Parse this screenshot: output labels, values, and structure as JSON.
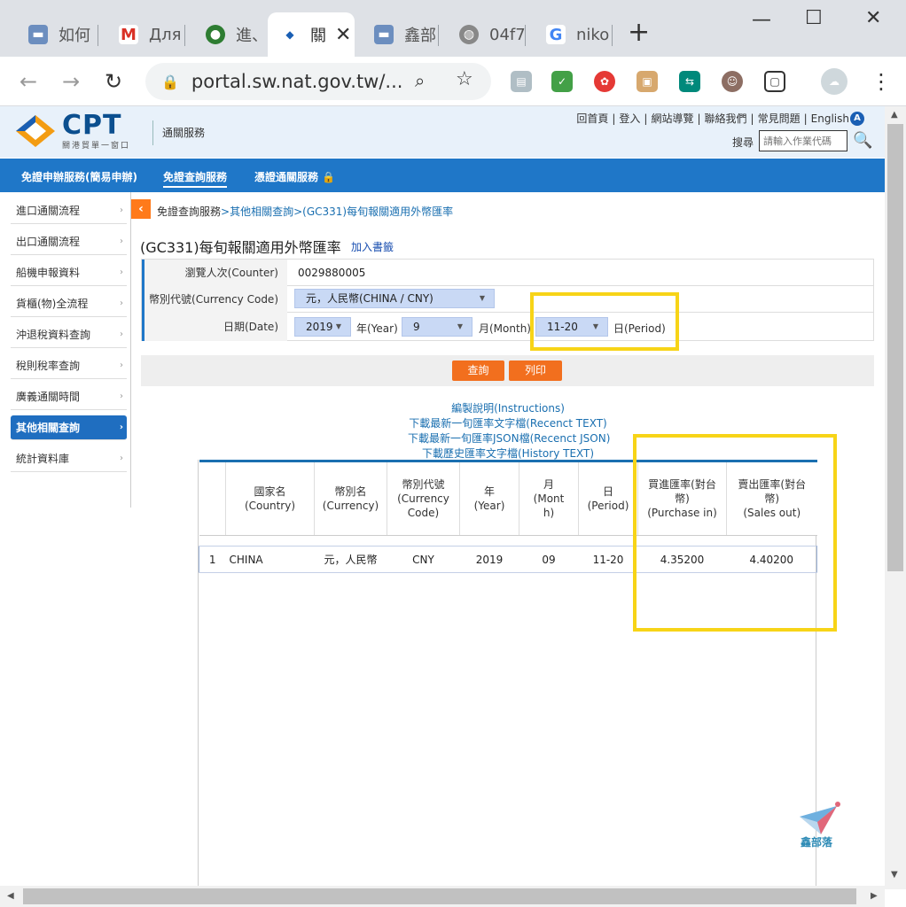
{
  "browser": {
    "tabs": [
      {
        "label": "如何",
        "icon": "chat-icon"
      },
      {
        "label": "Для",
        "icon": "gmail-icon"
      },
      {
        "label": "進、",
        "icon": "emblem-icon"
      },
      {
        "label": "關",
        "icon": "cpt-icon",
        "close": "✕"
      },
      {
        "label": "鑫部",
        "icon": "chat-icon"
      },
      {
        "label": "04f7",
        "icon": "globe-icon"
      },
      {
        "label": "niko",
        "icon": "google-icon"
      }
    ],
    "new_tab": "+",
    "window": {
      "minimize": "—",
      "maximize": "☐",
      "close": "✕"
    },
    "url": "portal.sw.nat.gov.tw/...",
    "nav": {
      "back": "←",
      "forward": "→",
      "reload": "↻",
      "menu": "⋮"
    }
  },
  "site": {
    "logo": "CPT",
    "logo_sub": "關港貿單一窗口",
    "service": "通關服務",
    "toplinks": [
      "回首頁",
      "登入",
      "網站導覽",
      "聯絡我們",
      "常見問題",
      "English"
    ],
    "search_label": "搜尋",
    "search_placeholder": "請輸入作業代碼",
    "nav": [
      "免證申辦服務(簡易申辦)",
      "免證查詢服務",
      "憑證通關服務"
    ],
    "sidebar": [
      "進口通關流程",
      "出口通關流程",
      "船機申報資料",
      "貨櫃(物)全流程",
      "沖退稅資料查詢",
      "稅則稅率查詢",
      "廣義通關時間",
      "其他相關查詢",
      "統計資料庫"
    ],
    "sidebar_active": 7,
    "breadcrumb": [
      "免證查詢服務",
      ">",
      "其他相關查詢",
      ">",
      "(GC331)每旬報關適用外幣匯率"
    ],
    "title": "(GC331)每旬報關適用外幣匯率",
    "bookmark": "加入書籤"
  },
  "form": {
    "counter_label": "瀏覽人次(Counter)",
    "counter_value": "0029880005",
    "currency_label": "幣別代號(Currency Code)",
    "currency_value": "元，人民幣(CHINA / CNY)",
    "date_label": "日期(Date)",
    "year_value": "2019",
    "year_unit": "年(Year)",
    "month_value": "9",
    "month_unit": "月(Month)",
    "period_value": "11-20",
    "period_unit": "日(Period)"
  },
  "buttons": {
    "query": "查詢",
    "print": "列印"
  },
  "links": [
    "編製說明(Instructions)",
    "下載最新一旬匯率文字檔(Recenct TEXT)",
    "下載最新一旬匯率JSON檔(Recenct JSON)",
    "下載歷史匯率文字檔(History TEXT)"
  ],
  "table": {
    "headers": [
      "",
      "國家名\n(Country)",
      "幣別名\n(Currency)",
      "幣別代號\n(Currency\nCode)",
      "年\n(Year)",
      "月\n(Mont\nh)",
      "日\n(Period)",
      "買進匯率(對台\n幣)\n(Purchase in)",
      "賣出匯率(對台\n幣)\n(Sales out)"
    ],
    "rows": [
      [
        "1",
        "CHINA",
        "元，人民幣",
        "CNY",
        "2019",
        "09",
        "11-20",
        "4.35200",
        "4.40200"
      ]
    ]
  },
  "watermark": "鑫部落",
  "colors": {
    "nav_blue": "#1f77c8",
    "accent_orange": "#f26f1e",
    "highlight_yellow": "#f7d417",
    "link_blue": "#1a6fb0"
  }
}
